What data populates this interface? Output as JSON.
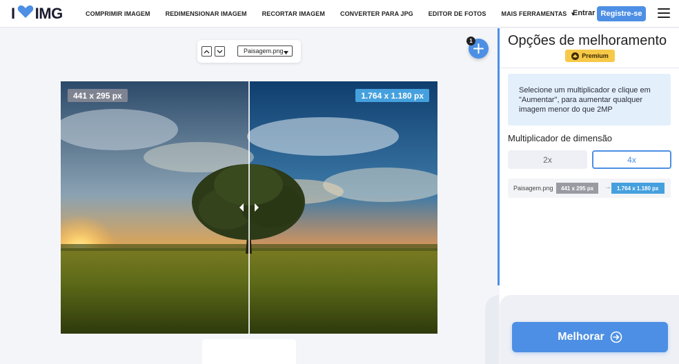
{
  "header": {
    "logo_text_left": "I",
    "logo_text_right": "IMG",
    "nav": [
      {
        "label": "COMPRIMIR IMAGEM"
      },
      {
        "label": "REDIMENSIONAR IMAGEM"
      },
      {
        "label": "RECORTAR IMAGEM"
      },
      {
        "label": "CONVERTER PARA JPG"
      },
      {
        "label": "EDITOR DE FOTOS"
      },
      {
        "label": "MAIS FERRAMENTAS"
      }
    ],
    "login_label": "Entrar",
    "register_label": "Registre-se"
  },
  "workspace": {
    "file_select_value": "Paisagem.png",
    "add_badge_count": "1",
    "original_dims": "441 x 295 px",
    "upscaled_dims": "1.764 x 1.180 px"
  },
  "sidebar": {
    "title": "Opções de melhoramento",
    "premium_label": "Premium",
    "info_text": "Selecione um multiplicador e clique em \"Aumentar\", para aumentar qualquer imagem menor do que 2MP",
    "multiplier_label": "Multiplicador de dimensão",
    "multipliers": [
      {
        "label": "2x",
        "selected": false
      },
      {
        "label": "4x",
        "selected": true
      }
    ],
    "file_row": {
      "name": "Paisagem.png",
      "old_dims": "441 x 295 px",
      "arrow": "→",
      "new_dims": "1.764 x 1.180 px"
    },
    "action_label": "Melhorar"
  },
  "colors": {
    "accent": "#4d8fe4",
    "dims_blue": "#45a0de",
    "premium": "#f7c948",
    "info_bg": "#e3f0fb"
  }
}
